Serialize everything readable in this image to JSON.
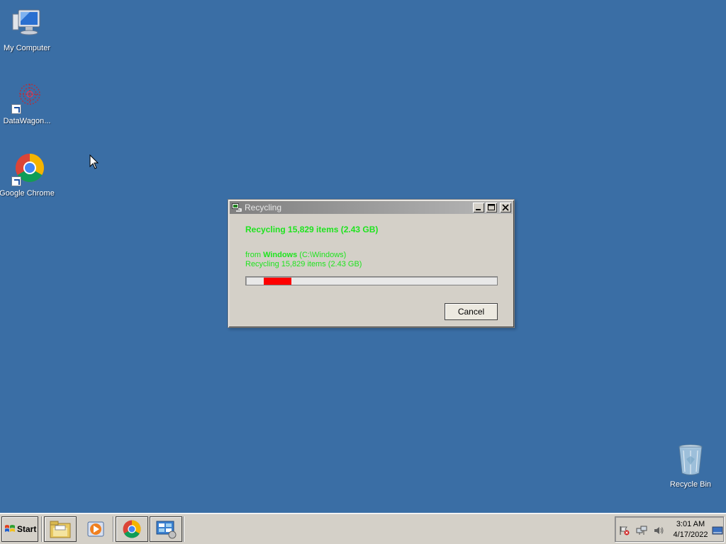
{
  "desktop": {
    "icons": [
      {
        "label": "My Computer",
        "icon": "my-computer-icon"
      },
      {
        "label": "DataWagon...",
        "icon": "datawagon-icon"
      },
      {
        "label": "Google Chrome",
        "icon": "chrome-icon"
      },
      {
        "label": "Recycle Bin",
        "icon": "recycle-bin-icon"
      }
    ],
    "background": "#3a6ea5"
  },
  "dialog": {
    "title": "Recycling",
    "heading": "Recycling 15,829 items (2.43 GB)",
    "from_prefix": "from ",
    "from_name": "Windows",
    "from_path": " (C:\\Windows)",
    "status": "Recycling 15,829 items (2.43 GB)",
    "progress": {
      "segment_start": 0.07,
      "segment_end": 0.18,
      "color": "#ff0000"
    },
    "text_color": "#1ee41e",
    "cancel_label": "Cancel"
  },
  "taskbar": {
    "start_label": "Start",
    "pinned": [
      {
        "icon": "explorer-folder-icon"
      },
      {
        "icon": "media-player-icon"
      },
      {
        "icon": "chrome-icon"
      },
      {
        "icon": "control-panel-icon"
      }
    ],
    "tray": {
      "icons": [
        "action-center-flag-icon",
        "network-icon",
        "volume-icon",
        "show-desktop-icon"
      ],
      "time": "3:01 AM",
      "date": "4/17/2022"
    }
  }
}
